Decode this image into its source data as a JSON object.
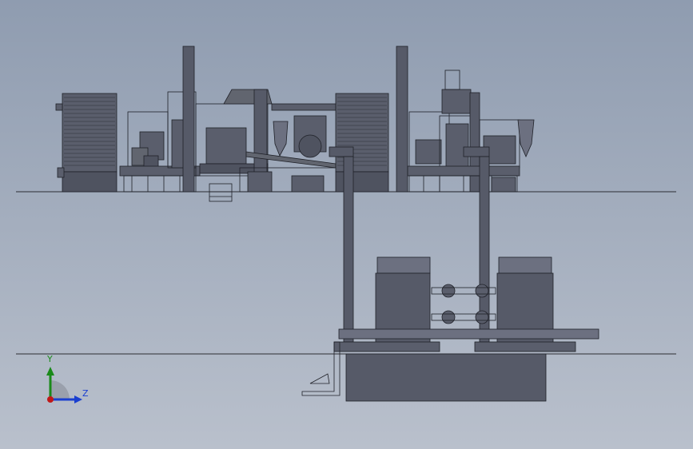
{
  "viewport": {
    "background_top": "#8f9cb0",
    "background_bottom": "#b9c0cc"
  },
  "model": {
    "body_color": "#565a68",
    "edge_color": "#1f2128",
    "ground_line_color": "#2b2d33",
    "detail_color": "#6c7080"
  },
  "triad": {
    "y_label": "Y",
    "z_label": "Z",
    "y_color": "#1a8a1a",
    "z_color": "#1a3fd0",
    "origin_color": "#c01818"
  }
}
